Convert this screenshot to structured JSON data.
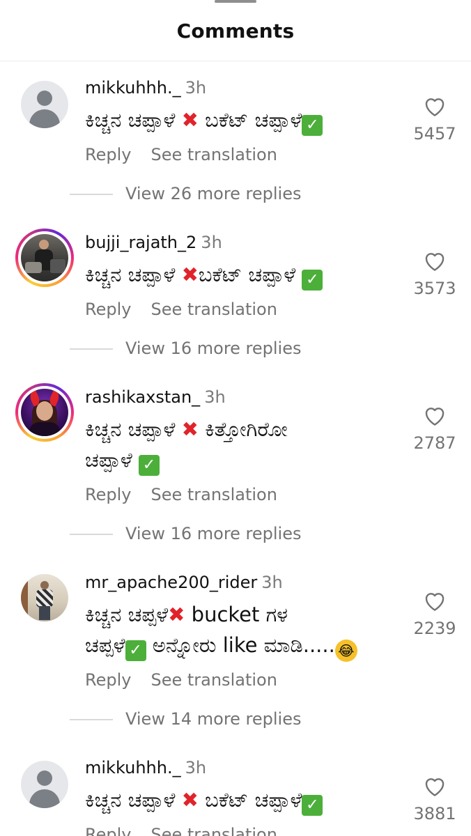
{
  "header": {
    "title": "Comments"
  },
  "comments": [
    {
      "username": "mikkuhhh._",
      "time": "3h",
      "text_before": "ಕಿಚ್ಚನ ಚಪ್ಪಾಳೆ ",
      "text_mid": " ಬಕೆಟ್ ಚಪ್ಪಾಳೆ",
      "likes": "5457",
      "reply_label": "Reply",
      "translate_label": "See translation",
      "more_replies": "View 26 more replies"
    },
    {
      "username": "bujji_rajath_2",
      "time": "3h",
      "text_before": "ಕಿಚ್ಚನ ಚಪ್ಪಾಳೆ ",
      "text_mid": "ಬಕೆಟ್ ಚಪ್ಪಾಳೆ ",
      "likes": "3573",
      "reply_label": "Reply",
      "translate_label": "See translation",
      "more_replies": "View 16 more replies"
    },
    {
      "username": "rashikaxstan_",
      "time": "3h",
      "text_line1_before": "ಕಿಚ್ಚನ ಚಪ್ಪಾಳೆ ",
      "text_line1_after": " ಕಿತ್ತೋಗಿರೋ",
      "text_line2": "ಚಪ್ಪಾಳೆ ",
      "likes": "2787",
      "reply_label": "Reply",
      "translate_label": "See translation",
      "more_replies": "View 16 more replies"
    },
    {
      "username": "mr_apache200_rider",
      "time": "3h",
      "text_line1_before": "ಕಿಚ್ಚನ ಚಪ್ಪಳೆ",
      "text_line1_after": " bucket ಗಳ",
      "text_line2_before": "ಚಪ್ಪಳೆ",
      "text_line2_after": " ಅನ್ನೋರು like ಮಾಡಿ.....",
      "likes": "2239",
      "reply_label": "Reply",
      "translate_label": "See translation",
      "more_replies": "View 14 more replies"
    },
    {
      "username": "mikkuhhh._",
      "time": "3h",
      "text_before": "ಕಿಚ್ಚನ ಚಪ್ಪಾಳೆ ",
      "text_mid": " ಬಕೆಟ್ ಚಪ್ಪಾಳೆ",
      "likes": "3881",
      "reply_label": "Reply",
      "translate_label": "See translation"
    }
  ],
  "icons": {
    "like": "heart-outline-icon",
    "cross": "cross-mark-icon",
    "check": "check-mark-icon",
    "laugh": "laughing-emoji-icon"
  },
  "colors": {
    "text": "#111111",
    "secondary": "#737373",
    "cross": "#e0242a",
    "check": "#4caf3a"
  }
}
